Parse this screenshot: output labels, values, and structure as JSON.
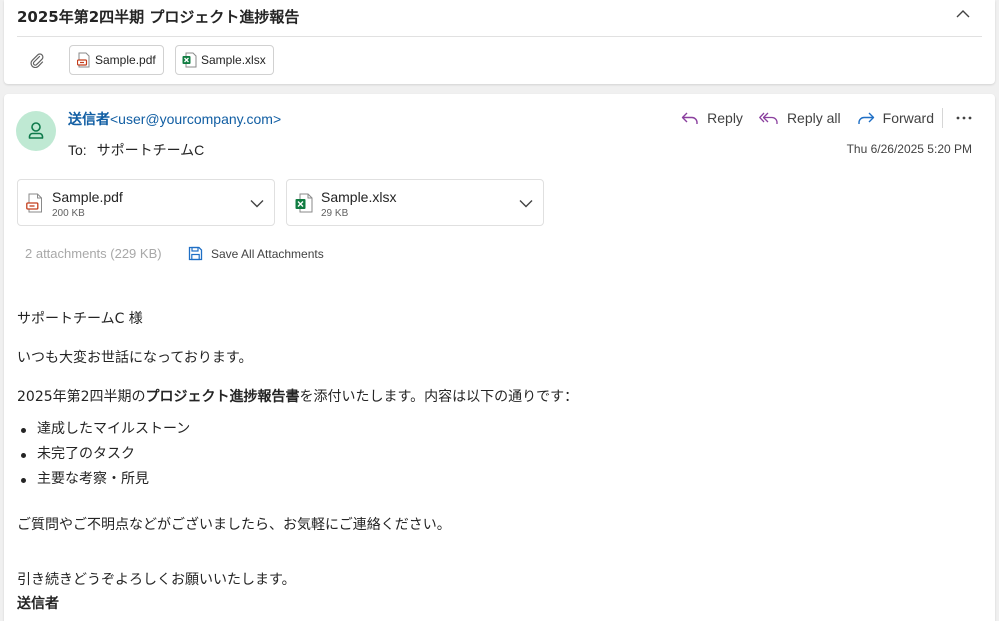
{
  "subject": "2025年第2四半期 プロジェクト進捗報告",
  "top_attachments": [
    {
      "name": "Sample.pdf",
      "icon": "pdf-file-icon"
    },
    {
      "name": "Sample.xlsx",
      "icon": "excel-file-icon"
    }
  ],
  "message": {
    "sender_name": "送信者",
    "sender_email": "<user@yourcompany.com>",
    "to_label": "To:",
    "to_value": "サポートチームC",
    "date": "Thu 6/26/2025 5:20 PM",
    "actions": {
      "reply": "Reply",
      "reply_all": "Reply all",
      "forward": "Forward"
    },
    "attachments": [
      {
        "name": "Sample.pdf",
        "size": "200 KB",
        "icon": "pdf-file-icon"
      },
      {
        "name": "Sample.xlsx",
        "size": "29 KB",
        "icon": "excel-file-icon"
      }
    ],
    "attachment_summary": "2 attachments (229 KB)",
    "save_all_label": "Save All Attachments",
    "body": {
      "greeting": "サポートチームC 様",
      "line1": "いつも大変お世話になっております。",
      "line2_pre": "2025年第2四半期の",
      "line2_bold": "プロジェクト進捗報告書",
      "line2_post": "を添付いたします。内容は以下の通りです：",
      "bullets": [
        "達成したマイルストーン",
        "未完了のタスク",
        "主要な考察・所見"
      ],
      "line3": "ご質問やご不明点などがございましたら、お気軽にご連絡ください。",
      "closing": "引き続きどうぞよろしくお願いいたします。",
      "signature": "送信者"
    }
  },
  "colors": {
    "link_blue": "#115ea3",
    "reply_purple": "#8a3f9e",
    "forward_blue": "#1f6fc5",
    "avatar_bg": "#bfe9d3",
    "avatar_fg": "#0e7a4b",
    "pdf_red": "#c43e1c",
    "excel_green": "#107c41"
  }
}
